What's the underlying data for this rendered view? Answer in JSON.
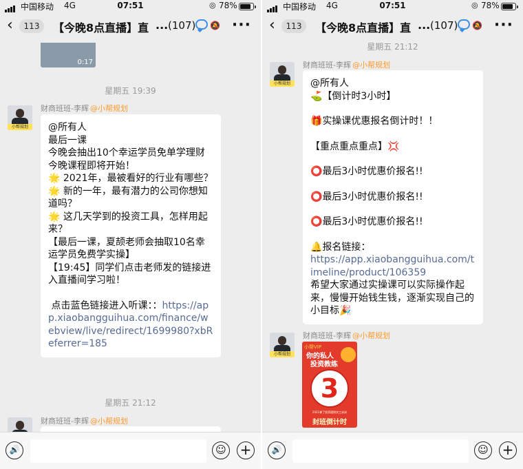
{
  "status": {
    "carrier": "中国移动",
    "network": "4G",
    "time": "07:51",
    "battery": "78%"
  },
  "nav": {
    "back_count": "113",
    "title": "【今晚8点直播】直",
    "ellipsis": "...",
    "members": "(107)",
    "more": "···"
  },
  "left": {
    "video_duration": "0:17",
    "time_sep_1": "星期五 19:39",
    "time_sep_2": "星期五 21:12",
    "sender_name": "财商班班-李辉",
    "sender_role": "@小帮规划",
    "avatar_tag": "小帮规划",
    "message": {
      "lines": [
        "@所有人",
        "最后一课",
        "今晚会抽出10个幸运学员免单学理财",
        "今晚课程即将开始！",
        "2021年，最被看好的行业有哪些？",
        "新的一年，最有潜力的公司你想知道吗？",
        "这几天学到的投资工具，怎样用起来？",
        "【最后一课，夏颉老师会抽取10名幸运学员免费学实操】",
        "【19:45】同学们点击老师发的链接进入直播间学习啦！",
        "点击蓝色链接进入听课：：",
        "https://app.xiaobangguihua.com/finance/webview/live/redirect/1699980?xbReferrer=185"
      ],
      "star": "🌟"
    }
  },
  "right": {
    "time_sep": "星期五 21:12",
    "sender_name": "财商班班-李辉",
    "sender_role": "@小帮规划",
    "avatar_tag": "小帮规划",
    "message": {
      "lines": [
        "@所有人",
        "【倒计时3小时】",
        "实操课优惠报名倒计时！！",
        "【重点重点重点】",
        "最后3小时优惠价报名!!",
        "最后3小时优惠价报名!!",
        "最后3小时优惠价报名!!",
        "报名链接：",
        "https://app.xiaobangguihua.com/timeline/product/106359",
        " 希望大家通过实操课可以实际操作起来，慢慢开始钱生钱，逐渐实现自己的小目标"
      ],
      "icons": {
        "golf": "⛳",
        "gift": "🎁",
        "anger": "💢",
        "circle": "⭕",
        "bell": "🔔",
        "party": "🎉"
      }
    },
    "poster": {
      "vip": "小帮VIP",
      "line1": "你的私人",
      "line2": "投资教练",
      "digit": "3",
      "small": "2021掌了投资理财实工训训",
      "banner": "封班倒计时"
    }
  },
  "inputbar": {
    "voice_icon": "🔊",
    "emoji_icon": "☺",
    "plus_icon": "+"
  }
}
